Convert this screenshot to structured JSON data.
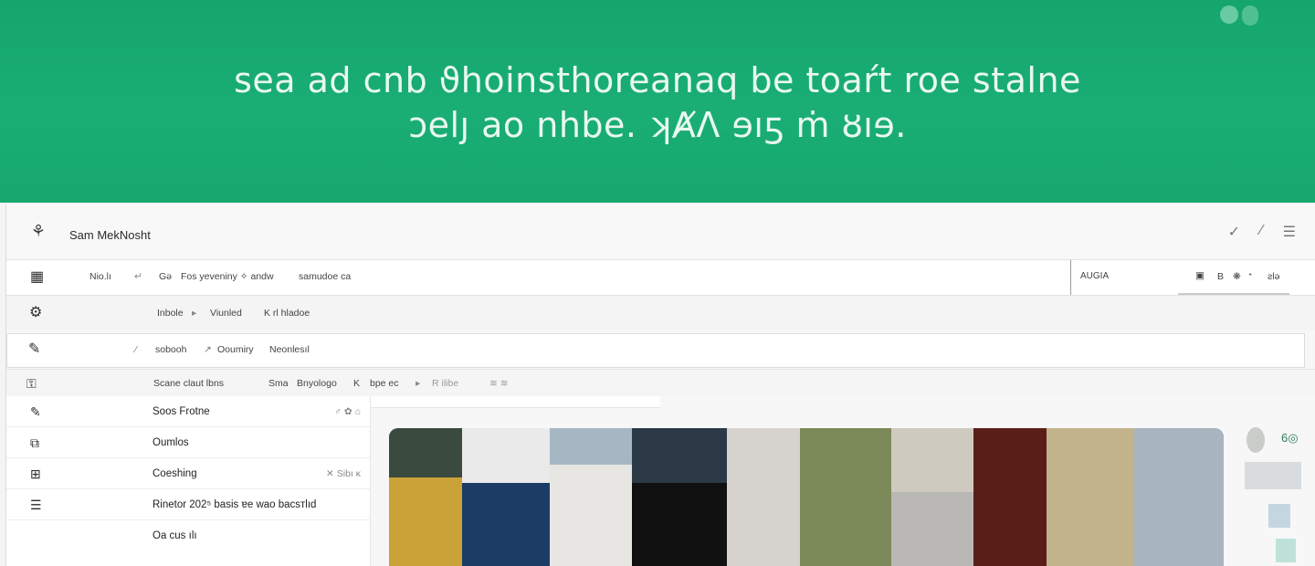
{
  "hero": {
    "line1": "sea ad cnb ϑhoinsthoreanaq be toaŕt roe stalne",
    "line2": "ɔelȷ ao nhbe. ʞȺɅ ɘıƽ ṁ ȣıɘ."
  },
  "window": {
    "title": "Sam MekNosht",
    "controls": [
      "✓",
      "⁄",
      "☰"
    ]
  },
  "row1": {
    "icon": "print-icon",
    "items": [
      "Nio.lı",
      "Gə",
      "Fos yeveniny ✧ andw",
      "samudoe ca"
    ],
    "right_label": "AUGIA",
    "right_items": [
      "▣",
      "B",
      "❋",
      "ᐩ",
      "ƨlə"
    ]
  },
  "row2": {
    "icon": "gear-icon",
    "items": [
      "Inbole",
      "▸",
      "Viunled",
      "K rl hladoe"
    ]
  },
  "row3": {
    "icon": "pen-icon",
    "items": [
      "sobooh",
      "Ooumiry",
      "Neonlesıl"
    ]
  },
  "row4": {
    "icon": "key-icon",
    "left": "Sсane claut lbns",
    "items": [
      "Sma",
      "Bnyologo",
      "K",
      "bpe ec",
      "▸",
      "R ilibe",
      "≋ ≋"
    ]
  },
  "sidebar": {
    "items": [
      {
        "icon": "edit-icon",
        "label": "Soos Frotne",
        "meta": "♂  ✿ ⌂"
      },
      {
        "icon": "copy-icon",
        "label": "Oumlos",
        "meta": ""
      },
      {
        "icon": "grid-icon",
        "label": "Coeshing",
        "meta": "✕  Sibı  ᴋ"
      },
      {
        "icon": "list-icon",
        "label": "Rinetor 202⁵  basis  ɐe  wao bacsᴛlıd",
        "meta": ""
      },
      {
        "icon": "blank-icon",
        "label": "Oa cus      ılı",
        "meta": ""
      }
    ]
  },
  "colors": {
    "hero_green": "#17a86e",
    "hero_text": "#e9f8f0",
    "window_bg": "#f7f7f7"
  }
}
